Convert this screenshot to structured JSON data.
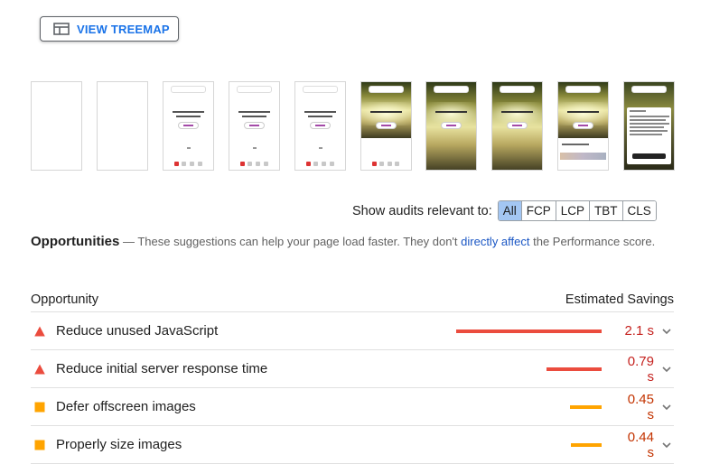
{
  "treemap_button": {
    "label": "VIEW TREEMAP",
    "icon": "treemap-icon",
    "color": "#1a73e8"
  },
  "filmstrip": {
    "frames": [
      {
        "kind": "blank"
      },
      {
        "kind": "blank"
      },
      {
        "kind": "text"
      },
      {
        "kind": "text"
      },
      {
        "kind": "text"
      },
      {
        "kind": "image"
      },
      {
        "kind": "image-full"
      },
      {
        "kind": "image-full"
      },
      {
        "kind": "image-strip"
      },
      {
        "kind": "modal"
      }
    ]
  },
  "audit_filter": {
    "label": "Show audits relevant to:",
    "options": [
      "All",
      "FCP",
      "LCP",
      "TBT",
      "CLS"
    ],
    "selected": "All"
  },
  "opportunities": {
    "heading": "Opportunities",
    "dash": " — ",
    "desc_before": "These suggestions can help your page load faster. They don't ",
    "link": "directly affect",
    "desc_after": " the Performance score."
  },
  "table": {
    "col_left": "Opportunity",
    "col_right": "Estimated Savings"
  },
  "rows": [
    {
      "title": "Reduce unused JavaScript",
      "value": "2.1 s",
      "severity": "fail",
      "bar_fraction": 1.0
    },
    {
      "title": "Reduce initial server response time",
      "value": "0.79 s",
      "severity": "fail",
      "bar_fraction": 0.38
    },
    {
      "title": "Defer offscreen images",
      "value": "0.45 s",
      "severity": "average",
      "bar_fraction": 0.22
    },
    {
      "title": "Properly size images",
      "value": "0.44 s",
      "severity": "average",
      "bar_fraction": 0.21
    }
  ],
  "colors": {
    "fail": "#eb4c3e",
    "fail_text": "#c5221f",
    "average": "#ffa400",
    "average_text": "#c33300",
    "active_filter": "#a3c6f3"
  }
}
